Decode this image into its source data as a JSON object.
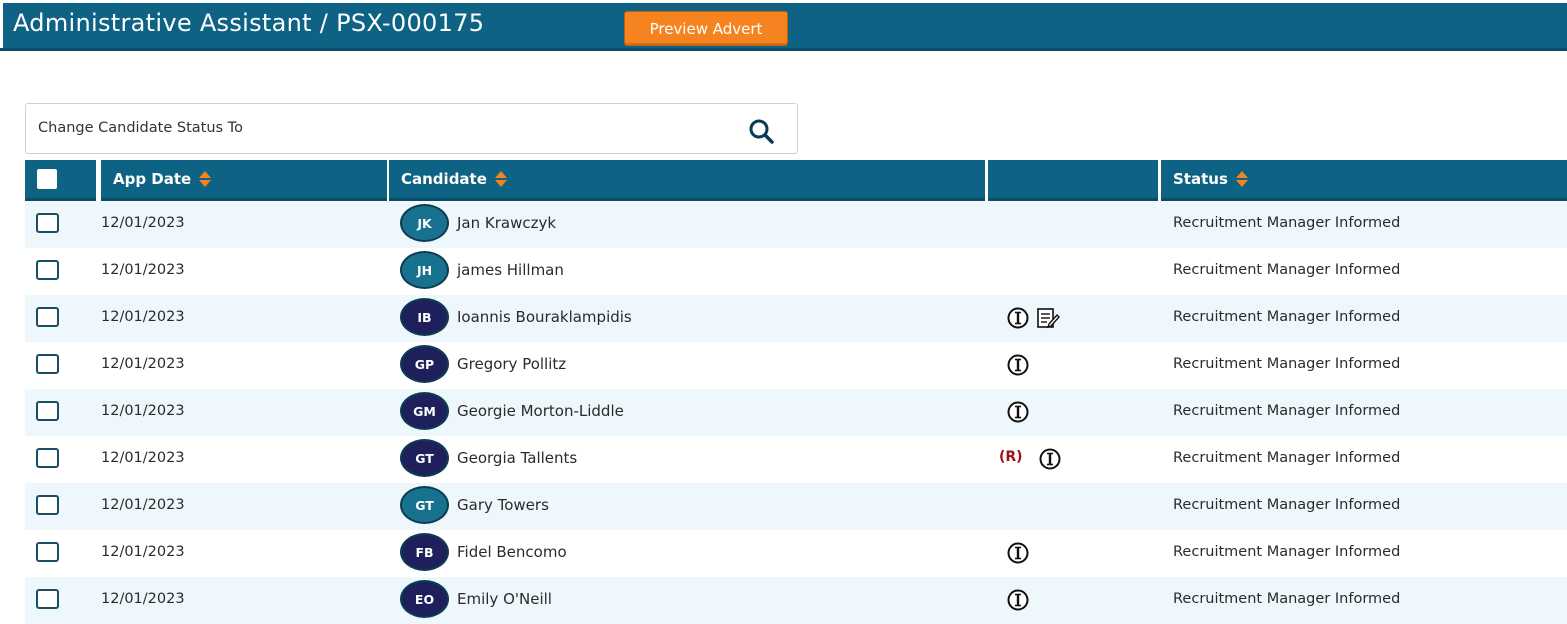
{
  "header": {
    "title": "Administrative Assistant / PSX-000175",
    "preview_button": "Preview Advert"
  },
  "search": {
    "label": "Change Candidate Status To",
    "icon": "search-icon"
  },
  "table": {
    "columns": [
      "",
      "App Date",
      "Candidate",
      "",
      "Status"
    ],
    "rows": [
      {
        "date": "12/01/2023",
        "initials": "JK",
        "name": "Jan Krawczyk",
        "status": "Recruitment Manager Informed",
        "avatar_color": "teal",
        "flags": []
      },
      {
        "date": "12/01/2023",
        "initials": "JH",
        "name": "james Hillman",
        "status": "Recruitment Manager Informed",
        "avatar_color": "teal",
        "flags": []
      },
      {
        "date": "12/01/2023",
        "initials": "IB",
        "name": "Ioannis Bouraklampidis",
        "status": "Recruitment Manager Informed",
        "avatar_color": "navy",
        "flags": [
          "info-icon",
          "notes-icon"
        ]
      },
      {
        "date": "12/01/2023",
        "initials": "GP",
        "name": "Gregory Pollitz",
        "status": "Recruitment Manager Informed",
        "avatar_color": "navy",
        "flags": [
          "info-icon"
        ]
      },
      {
        "date": "12/01/2023",
        "initials": "GM",
        "name": "Georgie Morton-Liddle",
        "status": "Recruitment Manager Informed",
        "avatar_color": "navy",
        "flags": [
          "info-icon"
        ]
      },
      {
        "date": "12/01/2023",
        "initials": "GT",
        "name": "Georgia Tallents",
        "status": "Recruitment Manager Informed",
        "avatar_color": "navy",
        "flags": [
          "R",
          "info-icon"
        ]
      },
      {
        "date": "12/01/2023",
        "initials": "GT",
        "name": "Gary Towers",
        "status": "Recruitment Manager Informed",
        "avatar_color": "teal",
        "flags": []
      },
      {
        "date": "12/01/2023",
        "initials": "FB",
        "name": "Fidel Bencomo",
        "status": "Recruitment Manager Informed",
        "avatar_color": "navy",
        "flags": [
          "info-icon"
        ]
      },
      {
        "date": "12/01/2023",
        "initials": "EO",
        "name": "Emily O'Neill",
        "status": "Recruitment Manager Informed",
        "avatar_color": "navy",
        "flags": [
          "info-icon"
        ]
      }
    ],
    "r_mark": "(R)"
  },
  "colors": {
    "header_bg": "#0e6283",
    "accent_orange": "#f5831f",
    "row_alt": "#eef7fb",
    "avatar_teal": "#17718f",
    "avatar_navy": "#1f1f5c",
    "r_flag": "#a01010"
  }
}
